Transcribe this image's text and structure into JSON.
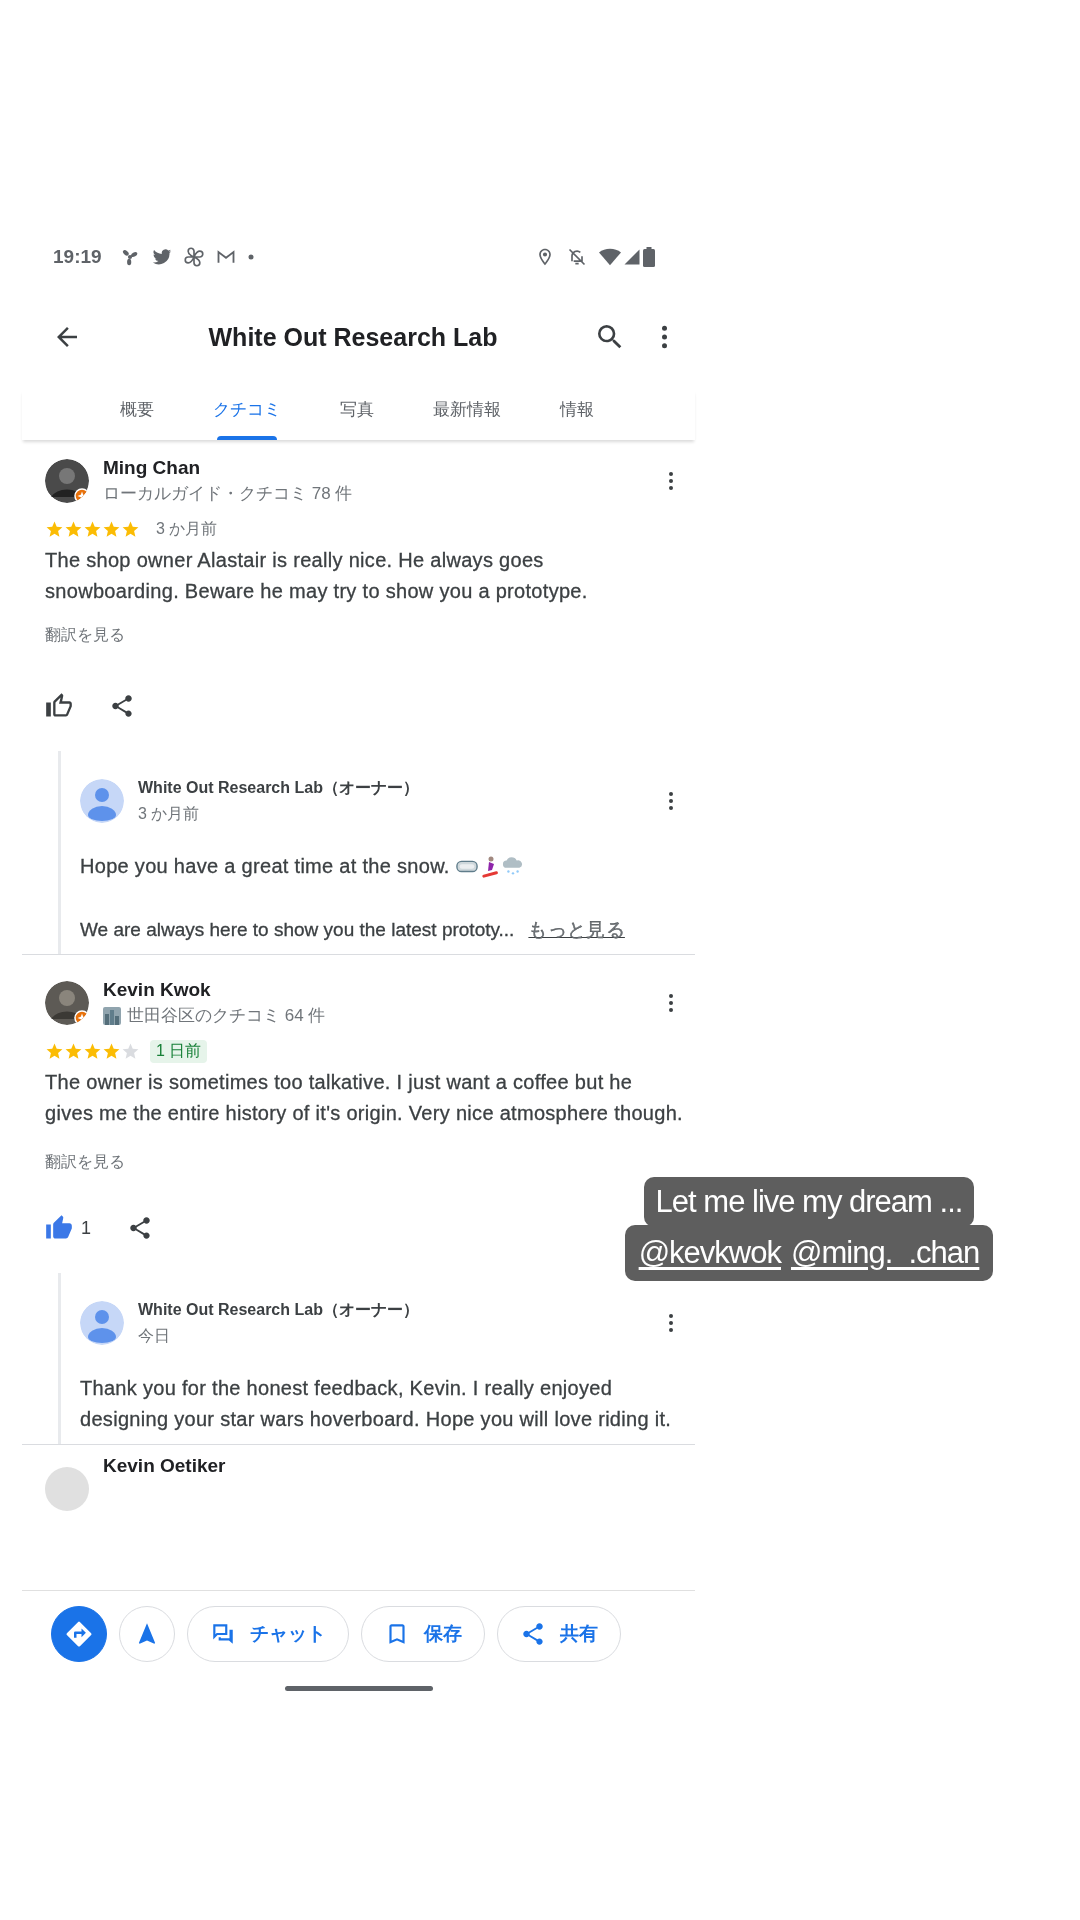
{
  "status_bar": {
    "time": "19:19"
  },
  "header": {
    "title": "White Out Research Lab"
  },
  "tabs": [
    {
      "label": "概要",
      "selected": false
    },
    {
      "label": "クチコミ",
      "selected": true
    },
    {
      "label": "写真",
      "selected": false
    },
    {
      "label": "最新情報",
      "selected": false
    },
    {
      "label": "情報",
      "selected": false
    }
  ],
  "reviews": [
    {
      "kind": "local_guide",
      "name": "Ming Chan",
      "subtitle": "ローカルガイド・クチコミ 78 件",
      "stars": 5,
      "time": "3 か月前",
      "new": false,
      "text": "The shop owner Alastair is really nice. He always goes snowboarding. Beware he may try to show you a prototype.",
      "translate": "翻訳を見る",
      "liked": false,
      "reply": {
        "name": "White Out Research Lab（オーナー）",
        "time": "3 か月前",
        "paragraphs": [
          {
            "kind": "with_emoji",
            "text": "Hope you have a great time at the snow."
          },
          {
            "kind": "plain",
            "text": "We are always here to show you the latest prototy..."
          }
        ],
        "more": "もっと見る"
      }
    },
    {
      "kind": "area_reviewer",
      "name": "Kevin Kwok",
      "subtitle": "世田谷区のクチコミ 64 件",
      "stars": 4,
      "time": "1 日前",
      "new": true,
      "text": "The owner is sometimes too talkative. I just want a coffee but he gives me the entire history of it's origin. Very nice atmosphere though.",
      "translate": "翻訳を見る",
      "liked": true,
      "likes": "1",
      "reply": {
        "name": "White Out Research Lab（オーナー）",
        "time": "今日",
        "paragraphs": [
          {
            "kind": "plain",
            "text": "Thank you for the honest feedback, Kevin. I really enjoyed designing your star wars hoverboard. Hope you will love riding it."
          }
        ]
      }
    }
  ],
  "next_reviewer": {
    "name": "Kevin Oetiker"
  },
  "actions": [
    {
      "kind": "directions"
    },
    {
      "kind": "navigate"
    },
    {
      "kind": "chat",
      "label": "チャット"
    },
    {
      "kind": "save",
      "label": "保存"
    },
    {
      "kind": "share",
      "label": "共有"
    }
  ],
  "caption": {
    "text": "Let me live my dream ...",
    "mentions": [
      "@kevkwok",
      "@ming._.chan"
    ]
  }
}
